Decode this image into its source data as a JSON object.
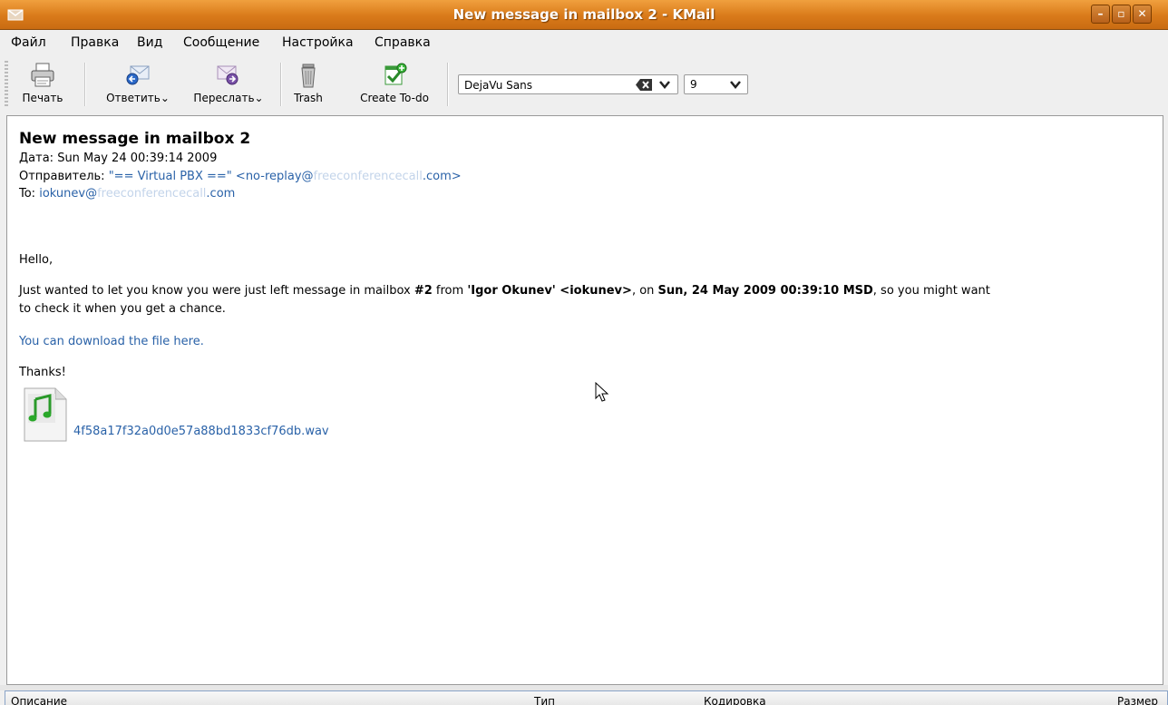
{
  "window": {
    "title": "New message in mailbox 2 - KMail"
  },
  "menu": [
    "Файл",
    "Правка",
    "Вид",
    "Сообщение",
    "Настройка",
    "Справка"
  ],
  "toolbar": {
    "print": "Печать",
    "reply": "Ответить",
    "forward": "Переслать",
    "trash": "Trash",
    "todo": "Create To-do",
    "font": "DejaVu Sans",
    "size": "9"
  },
  "message": {
    "subject": "New message in mailbox 2",
    "date_label": "Дата:",
    "date": "Sun May 24 00:39:14 2009",
    "from_label": "Отправитель:",
    "from_name": "\"== Virtual PBX ==\"",
    "from_addr_a": "<no-replay@",
    "from_addr_blur": "freeconferencecall",
    "from_addr_b": ".com>",
    "to_label": "To:",
    "to_a": "iokunev@",
    "to_blur": "freeconferencecall",
    "to_b": ".com",
    "greeting": "Hello,",
    "p1_a": "Just wanted to let you know you were just left message in mailbox ",
    "p1_box": "#2",
    "p1_b": " from ",
    "p1_caller": "'Igor Okunev' <iokunev>",
    "p1_c": ", on ",
    "p1_date": "Sun, 24 May 2009 00:39:10 MSD",
    "p1_d": ", so you might want",
    "p1_e": "to check it when you get a chance.",
    "download": "You can download the file here.",
    "thanks": "Thanks!",
    "attachment": "4f58a17f32a0d0e57a88bd1833cf76db.wav"
  },
  "attachments_header": {
    "desc": "Описание",
    "type": "Тип",
    "encoding": "Кодировка",
    "size": "Размер"
  }
}
